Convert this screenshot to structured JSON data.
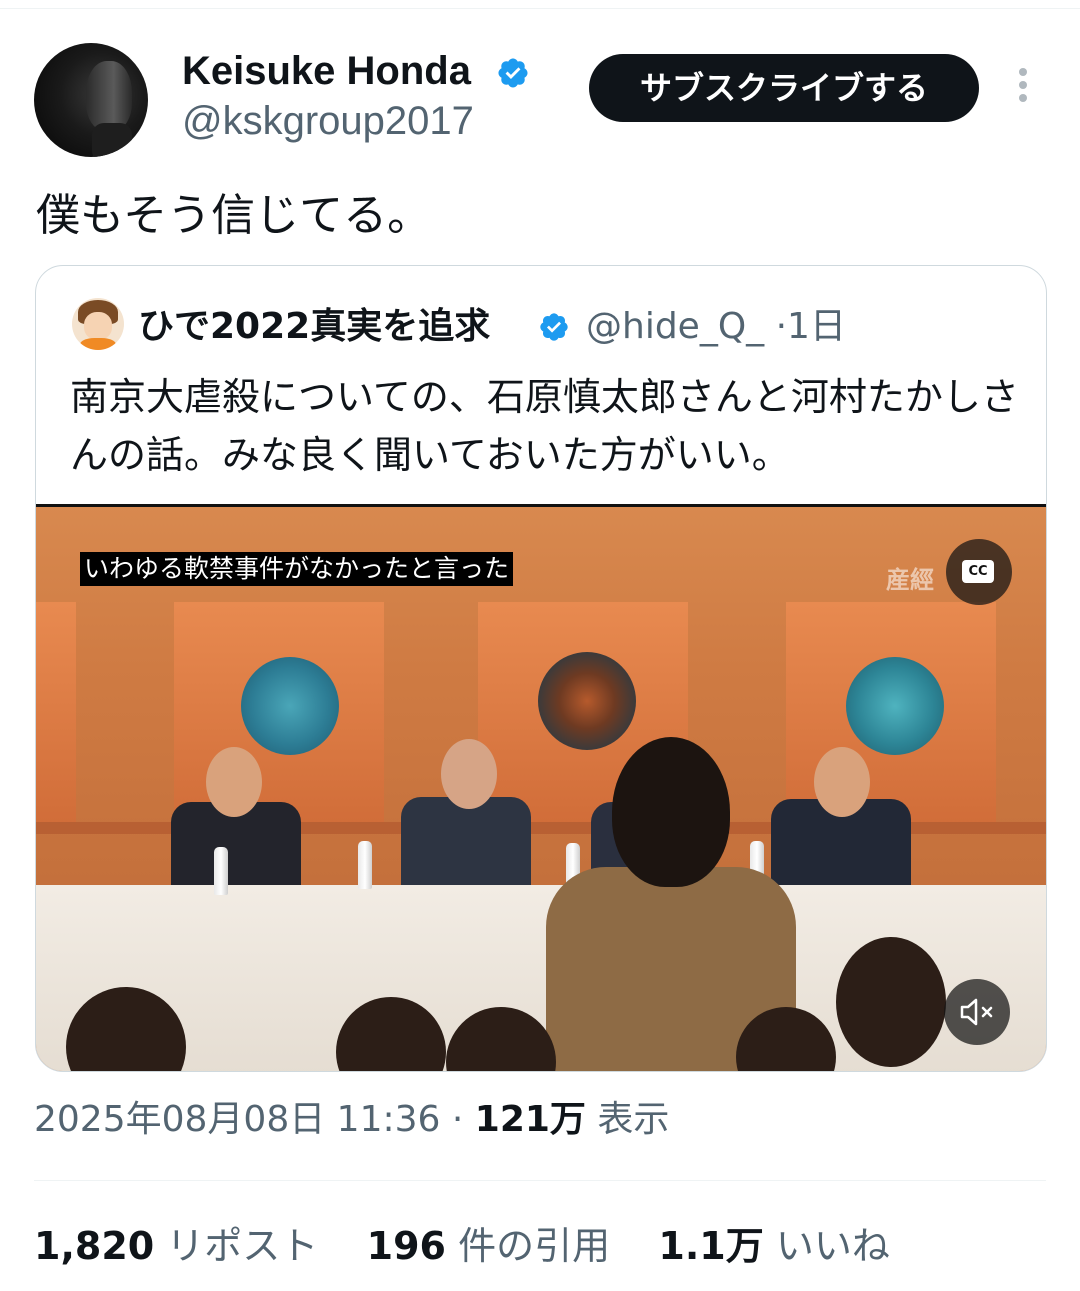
{
  "author": {
    "name": "Keisuke Honda",
    "handle": "@kskgroup2017",
    "verified": true,
    "subscribe_label": "サブスクライブする"
  },
  "tweet": {
    "text": "僕もそう信じてる。",
    "timestamp": "2025年08月08日 11:36",
    "views_count": "121万",
    "views_label": "表示"
  },
  "quoted_tweet": {
    "name": "ひで2022真実を追求",
    "handle": "@hide_Q_",
    "age": "·1日",
    "text": "南京大虐殺についての、石原慎太郎さんと河村たかしさんの話。みな良く聞いておいた方がいい。",
    "video": {
      "caption": "いわゆる軟禁事件がなかったと言った",
      "watermark": "産經",
      "cc_label": "CC"
    }
  },
  "stats": {
    "reposts_count": "1,820",
    "reposts_label": "リポスト",
    "quotes_count": "196",
    "quotes_label": "件の引用",
    "likes_count": "1.1万",
    "likes_label": "いいね"
  },
  "colors": {
    "verified_blue": "#1d9bf0",
    "secondary_text": "#536471",
    "button_black": "#0f1419"
  }
}
